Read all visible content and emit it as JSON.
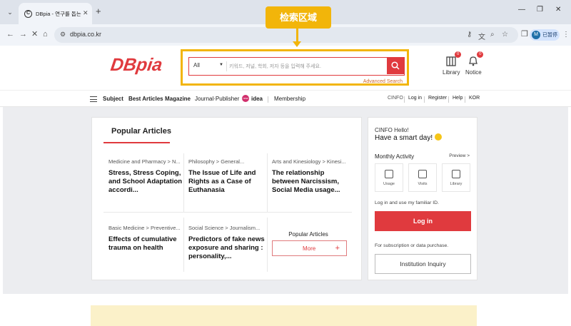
{
  "browser": {
    "tab_title": "DBpia - 연구를 돕는 똑똑한 학",
    "tab_favicon": "C",
    "url": "dbpia.co.kr",
    "profile_initial": "M",
    "profile_label": "已暂停"
  },
  "annotation": {
    "label": "检索区域",
    "color": "#f2b50a"
  },
  "header": {
    "logo": "DBpia",
    "search": {
      "scope": "All",
      "placeholder": "키워드, 저널, 학회, 저자 등을 입력해 주세요.",
      "advanced_label": "Advanced Search"
    },
    "icons": [
      {
        "label": "Library",
        "badge": "0",
        "icon": "library-icon"
      },
      {
        "label": "Notice",
        "badge": "0",
        "icon": "bell-icon"
      }
    ]
  },
  "nav": {
    "items": [
      "Subject",
      "Best Articles",
      "Magazine",
      "Journal·Publisher",
      "idea",
      "Membership"
    ],
    "right": [
      "CINFO",
      "Log in",
      "Register",
      "Help",
      "KOR"
    ]
  },
  "popular": {
    "title": "Popular Articles",
    "articles": [
      {
        "category": "Medicine and Pharmacy > N...",
        "title": "Stress, Stress Coping, and School Adaptation accordi..."
      },
      {
        "category": "Philosophy > General...",
        "title": "The Issue of Life and Rights as a Case of Euthanasia"
      },
      {
        "category": "Arts and Kinesiology > Kinesi...",
        "title": "The relationship between Narcissism, Social Media usage..."
      },
      {
        "category": "Basic Medicine > Preventive...",
        "title": "Effects of cumulative trauma on health"
      },
      {
        "category": "Social Science > Journalism...",
        "title": "Predictors of fake news exposure and sharing : personality,..."
      }
    ],
    "more_caption": "Popular Articles",
    "more_label": "More",
    "more_plus": "+"
  },
  "side": {
    "hello": "CINFO Hello!",
    "smart": "Have a smart day!",
    "monthly": "Monthly Activity",
    "preview": "Preview >",
    "activities": [
      "Usage",
      "Visits",
      "Library"
    ],
    "login_text": "Log in and use my familiar ID.",
    "login_label": "Log in",
    "subscription_text": "For subscription or data purchase.",
    "institution_label": "Institution Inquiry"
  }
}
